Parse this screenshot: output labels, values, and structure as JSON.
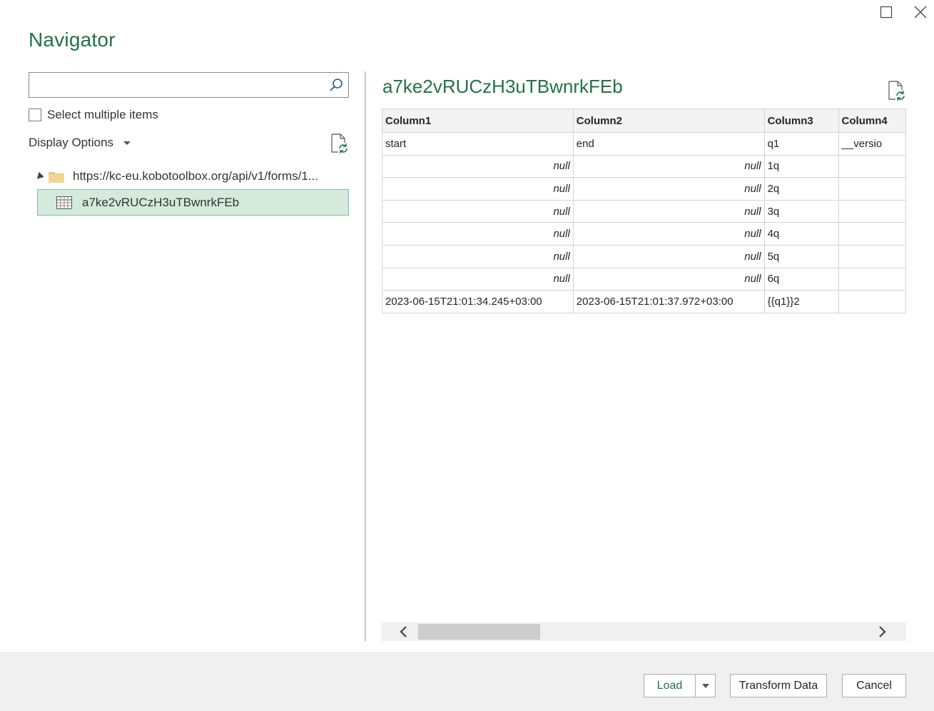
{
  "window": {
    "title": "Navigator"
  },
  "left_pane": {
    "search": {
      "value": "",
      "placeholder": ""
    },
    "select_multiple_label": "Select multiple items",
    "select_multiple_checked": false,
    "display_options_label": "Display Options",
    "tree": {
      "root_label": "https://kc-eu.kobotoolbox.org/api/v1/forms/1...",
      "child_label": "a7ke2vRUCzH3uTBwnrkFEb",
      "child_selected": true
    }
  },
  "preview": {
    "title": "a7ke2vRUCzH3uTBwnrkFEb",
    "columns": [
      "Column1",
      "Column2",
      "Column3",
      "Column4"
    ],
    "rows": [
      [
        "start",
        "end",
        "q1",
        "__versio"
      ],
      [
        "null",
        "null",
        "1q",
        ""
      ],
      [
        "null",
        "null",
        "2q",
        ""
      ],
      [
        "null",
        "null",
        "3q",
        ""
      ],
      [
        "null",
        "null",
        "4q",
        ""
      ],
      [
        "null",
        "null",
        "5q",
        ""
      ],
      [
        "null",
        "null",
        "6q",
        ""
      ],
      [
        "2023-06-15T21:01:34.245+03:00",
        "2023-06-15T21:01:37.972+03:00",
        "{{q1}}2",
        ""
      ]
    ]
  },
  "footer": {
    "load_label": "Load",
    "transform_label": "Transform Data",
    "cancel_label": "Cancel"
  },
  "colors": {
    "accent": "#217346",
    "selected_bg": "#d3eadd",
    "footer_bg": "#f0f0f0"
  }
}
